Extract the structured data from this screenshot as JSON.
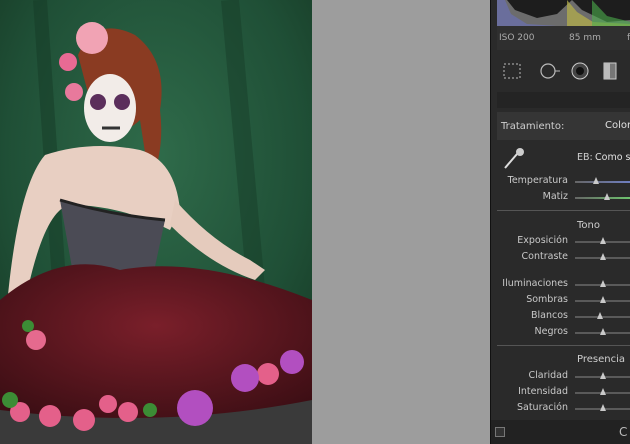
{
  "photo": {
    "description_icon": "photo-preview"
  },
  "histogram": {
    "iso": "ISO 200",
    "focal": "85 mm",
    "fstop": "f"
  },
  "tools": [
    "crop-icon",
    "spot-removal-icon",
    "red-eye-icon",
    "graduated-filter-icon"
  ],
  "treatment": {
    "label": "Tratamiento:",
    "value": "Color"
  },
  "wb": {
    "label": "EB:",
    "value": "Como s"
  },
  "sliders_wb": [
    {
      "label": "Temperatura",
      "value": 0.38
    },
    {
      "label": "Matiz",
      "value": 0.58
    }
  ],
  "tone": {
    "header": "Tono",
    "sliders": [
      {
        "label": "Exposición",
        "value": 0.5
      },
      {
        "label": "Contraste",
        "value": 0.5
      },
      {
        "label": "Iluminaciones",
        "value": 0.5
      },
      {
        "label": "Sombras",
        "value": 0.5
      },
      {
        "label": "Blancos",
        "value": 0.45
      },
      {
        "label": "Negros",
        "value": 0.5
      }
    ]
  },
  "presence": {
    "header": "Presencia",
    "sliders": [
      {
        "label": "Claridad",
        "value": 0.5
      },
      {
        "label": "Intensidad",
        "value": 0.5
      },
      {
        "label": "Saturación",
        "value": 0.5
      }
    ]
  },
  "bottom": {
    "toggle_label": "C"
  },
  "colors": {
    "accent_temp": "#6f7fc2",
    "accent_tint": "#6ec56e"
  }
}
